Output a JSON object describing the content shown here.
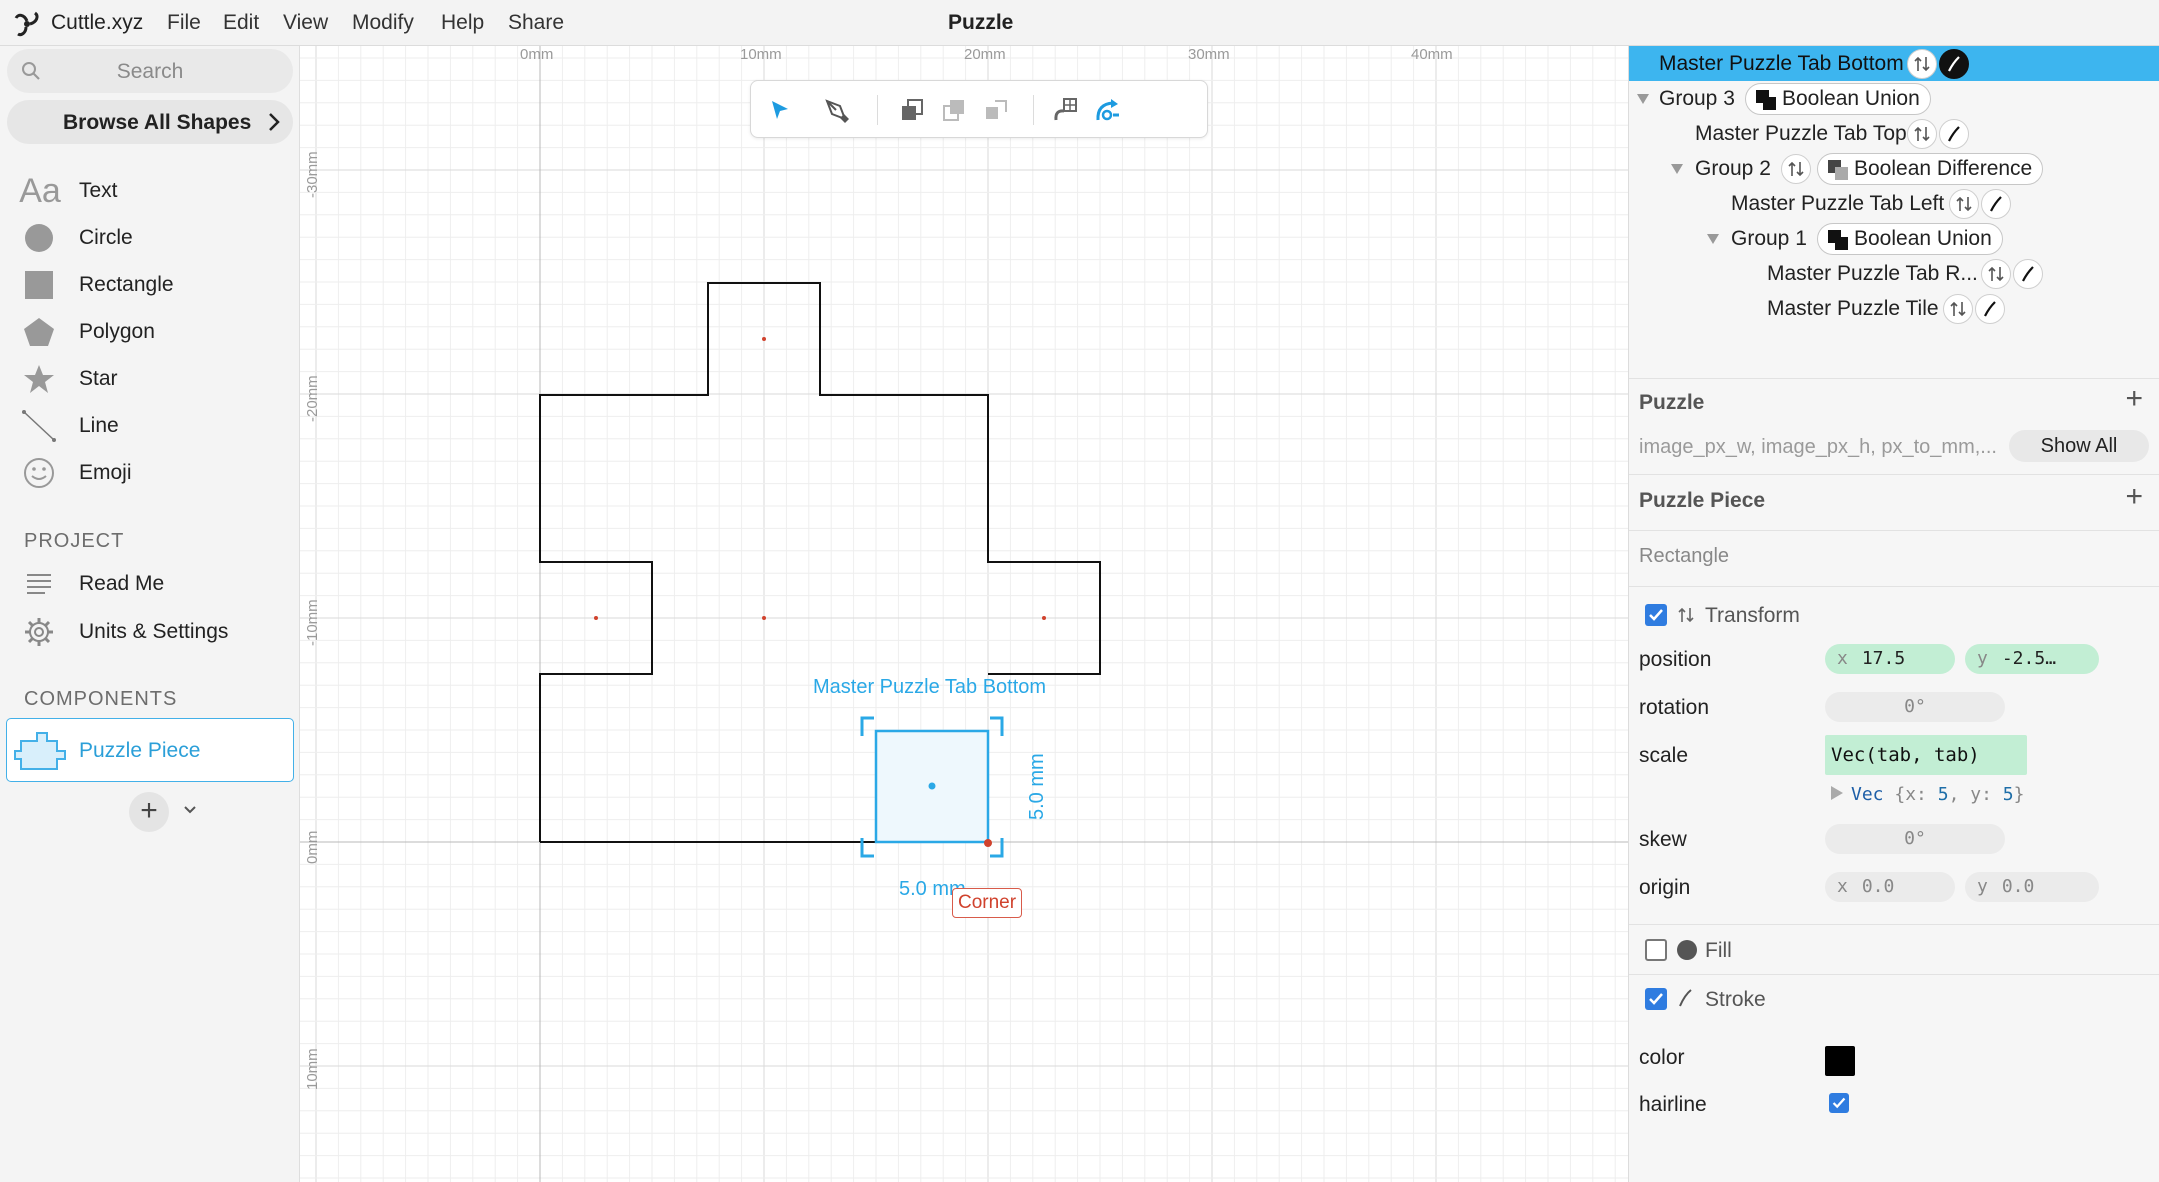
{
  "menubar": {
    "app_name": "Cuttle.xyz",
    "menus": [
      "File",
      "Edit",
      "View",
      "Modify",
      "Help",
      "Share"
    ],
    "document_title": "Puzzle"
  },
  "sidebar": {
    "search_placeholder": "Search",
    "browse_label": "Browse All Shapes",
    "shapes": [
      {
        "label": "Text",
        "icon": "text-icon"
      },
      {
        "label": "Circle",
        "icon": "circle-icon"
      },
      {
        "label": "Rectangle",
        "icon": "rectangle-icon"
      },
      {
        "label": "Polygon",
        "icon": "polygon-icon"
      },
      {
        "label": "Star",
        "icon": "star-icon"
      },
      {
        "label": "Line",
        "icon": "line-icon"
      },
      {
        "label": "Emoji",
        "icon": "emoji-icon"
      }
    ],
    "project_header": "PROJECT",
    "project_items": [
      {
        "label": "Read Me",
        "icon": "document-lines-icon"
      },
      {
        "label": "Units & Settings",
        "icon": "gear-icon"
      }
    ],
    "components_header": "COMPONENTS",
    "components": [
      {
        "label": "Puzzle Piece",
        "icon": "puzzle-piece-icon",
        "selected": true
      }
    ],
    "add_label": "+"
  },
  "canvas": {
    "ruler_top": [
      "0mm",
      "10mm",
      "20mm",
      "30mm",
      "40mm"
    ],
    "ruler_left": [
      "-30mm",
      "-20mm",
      "-10mm",
      "0mm",
      "10mm"
    ],
    "selection_title": "Master Puzzle Tab Bottom",
    "height_label": "5.0 mm",
    "width_label": "5.0 mm",
    "corner_tooltip": "Corner",
    "toolbar": [
      "select-arrow-icon",
      "pen-icon",
      "bring-forward-icon",
      "send-backward-icon",
      "flip-icon",
      "link-icon",
      "rotate-tool-icon"
    ],
    "colors": {
      "selection": "#2aa8e6",
      "outline": "#111111",
      "corner_point": "#d0422d"
    }
  },
  "tree": {
    "rows": [
      {
        "label": "Master Puzzle Tab Bottom",
        "selected": true
      },
      {
        "label": "Group 3",
        "operation": "Boolean Union"
      },
      {
        "label": "Master Puzzle Tab Top"
      },
      {
        "label": "Group 2",
        "operation": "Boolean Difference"
      },
      {
        "label": "Master Puzzle Tab Left"
      },
      {
        "label": "Group 1",
        "operation": "Boolean Union"
      },
      {
        "label": "Master Puzzle Tab R..."
      },
      {
        "label": "Master Puzzle Tile"
      }
    ]
  },
  "inspector": {
    "puzzle_header": "Puzzle",
    "puzzle_params": "image_px_w, image_px_h, px_to_mm,...",
    "show_all": "Show All",
    "piece_header": "Puzzle Piece",
    "shape_type": "Rectangle",
    "transform_label": "Transform",
    "transform_checked": true,
    "position_label": "position",
    "position_x": "17.5",
    "position_y": "-2.5…",
    "rotation_label": "rotation",
    "rotation_value": "0°",
    "scale_label": "scale",
    "scale_value": "Vec(tab, tab)",
    "scale_eval_type": "Vec",
    "scale_eval_open": "{x: ",
    "scale_eval_x": "5",
    "scale_eval_mid": ", y: ",
    "scale_eval_y": "5",
    "scale_eval_close": "}",
    "skew_label": "skew",
    "skew_value": "0°",
    "origin_label": "origin",
    "origin_x": "0.0",
    "origin_y": "0.0",
    "axis_x": "x",
    "axis_y": "y",
    "fill_label": "Fill",
    "fill_checked": false,
    "stroke_label": "Stroke",
    "stroke_checked": true,
    "color_label": "color",
    "stroke_color": "#000000",
    "hairline_label": "hairline",
    "hairline_checked": true
  }
}
